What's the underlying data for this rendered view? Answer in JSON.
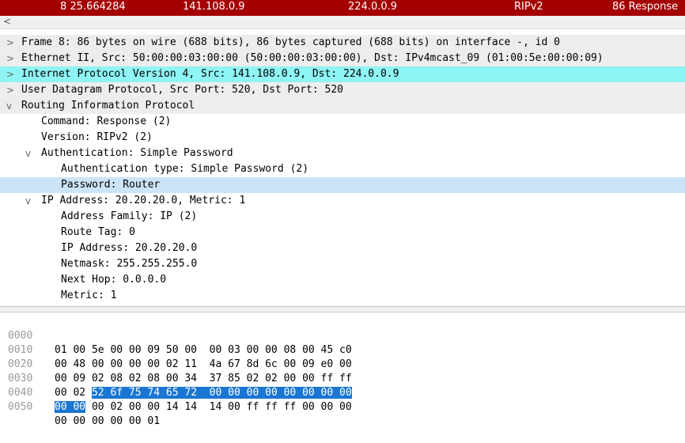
{
  "packet": {
    "no_time": "8 25.664284",
    "src": "141.108.0.9",
    "dst": "224.0.0.9",
    "protocol": "RIPv2",
    "info": "86 Response"
  },
  "scroll_left_arrow": "<",
  "tree": [
    {
      "text": "Frame 8: 86 bytes on wire (688 bits), 86 bytes captured (688 bits) on interface -, id 0",
      "toggle": ">"
    },
    {
      "text": "Ethernet II, Src: 50:00:00:03:00:00 (50:00:00:03:00:00), Dst: IPv4mcast_09 (01:00:5e:00:00:09)",
      "toggle": ">"
    },
    {
      "text": "Internet Protocol Version 4, Src: 141.108.0.9, Dst: 224.0.0.9",
      "toggle": ">"
    },
    {
      "text": "User Datagram Protocol, Src Port: 520, Dst Port: 520",
      "toggle": ">"
    },
    {
      "text": "Routing Information Protocol",
      "toggle": "v"
    },
    {
      "text": "Command: Response (2)",
      "toggle": ""
    },
    {
      "text": "Version: RIPv2 (2)",
      "toggle": ""
    },
    {
      "text": "Authentication: Simple Password",
      "toggle": "v"
    },
    {
      "text": "Authentication type: Simple Password (2)",
      "toggle": ""
    },
    {
      "text": "Password: Router",
      "toggle": ""
    },
    {
      "text": "IP Address: 20.20.20.0, Metric: 1",
      "toggle": "v"
    },
    {
      "text": "Address Family: IP (2)",
      "toggle": ""
    },
    {
      "text": "Route Tag: 0",
      "toggle": ""
    },
    {
      "text": "IP Address: 20.20.20.0",
      "toggle": ""
    },
    {
      "text": "Netmask: 255.255.255.0",
      "toggle": ""
    },
    {
      "text": "Next Hop: 0.0.0.0",
      "toggle": ""
    },
    {
      "text": "Metric: 1",
      "toggle": ""
    }
  ],
  "hex": [
    {
      "offset": "0000",
      "pre": "01 00 5e 00 00 09 50 00  00 03 00 00 08 00 45 c0",
      "sel": "",
      "post": ""
    },
    {
      "offset": "0010",
      "pre": "00 48 00 00 00 00 02 11  4a 67 8d 6c 00 09 e0 00",
      "sel": "",
      "post": ""
    },
    {
      "offset": "0020",
      "pre": "00 09 02 08 02 08 00 34  37 85 02 02 00 00 ff ff",
      "sel": "",
      "post": ""
    },
    {
      "offset": "0030",
      "pre": "00 02 ",
      "sel": "52 6f 75 74 65 72  00 00 00 00 00 00 00 00",
      "post": ""
    },
    {
      "offset": "0040",
      "pre": "",
      "sel": "00 00",
      "post": " 00 02 00 00 14 14  14 00 ff ff ff 00 00 00"
    },
    {
      "offset": "0050",
      "pre": "00 00 00 00 00 01",
      "sel": "",
      "post": ""
    }
  ]
}
